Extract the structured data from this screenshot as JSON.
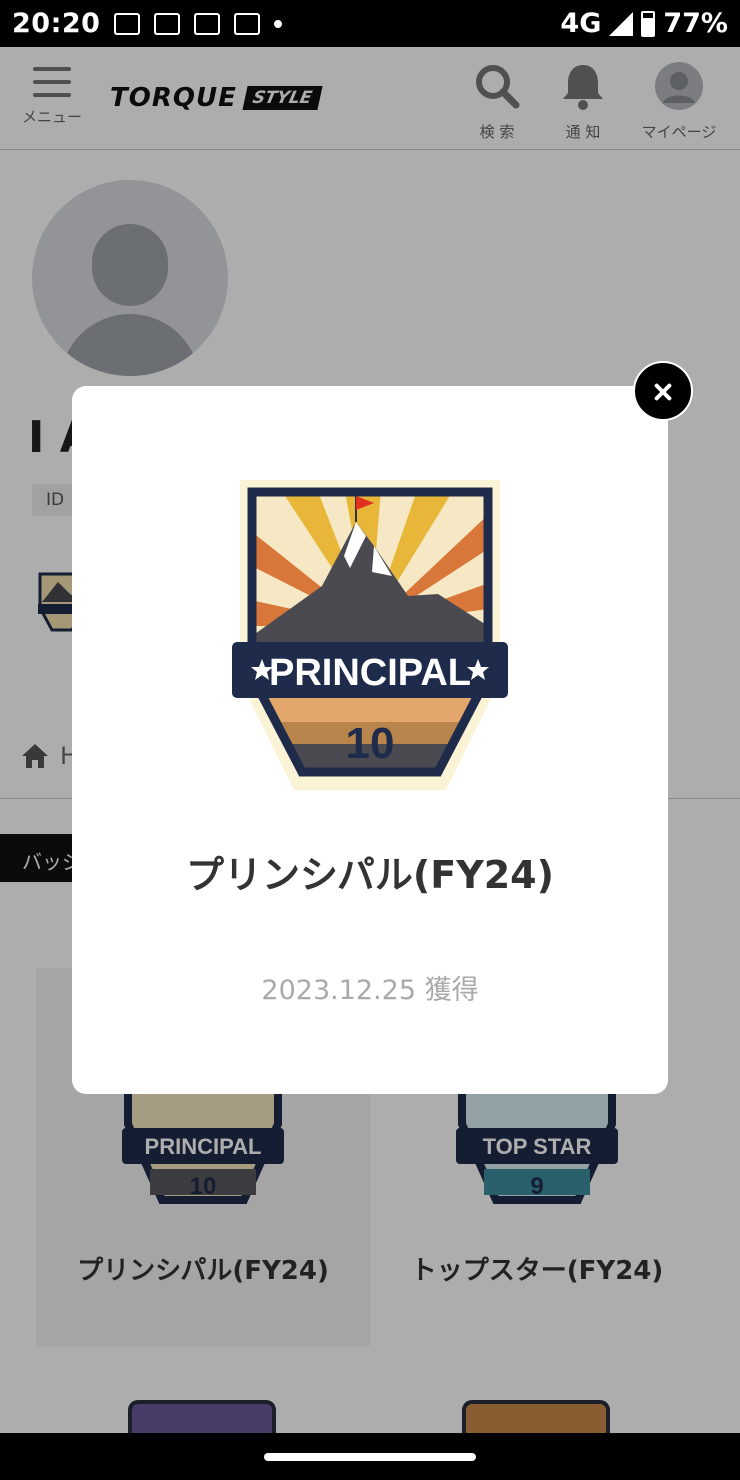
{
  "status_bar": {
    "time": "20:20",
    "network": "4G",
    "battery": "77%"
  },
  "header": {
    "menu_label": "メニュー",
    "logo_text": "TORQUE",
    "logo_tag": "STYLE",
    "search_label": "検 索",
    "notify_label": "通 知",
    "mypage_label": "マイページ"
  },
  "profile": {
    "name": "I A",
    "id_label": "ID"
  },
  "nav": {
    "home_text": "H"
  },
  "tabs": {
    "active_label": "バッジ"
  },
  "badges": [
    {
      "banner": "PRINCIPAL",
      "number": "10",
      "label": "プリンシパル(FY24)"
    },
    {
      "banner": "TOP STAR",
      "number": "9",
      "label": "トップスター(FY24)"
    }
  ],
  "modal": {
    "badge_banner": "PRINCIPAL",
    "badge_number": "10",
    "title": "プリンシパル(FY24)",
    "date": "2023.12.25 獲得"
  },
  "colors": {
    "navy": "#1f2b4a",
    "sun_yellow": "#e8b73a",
    "sun_orange": "#d9773a",
    "mountain": "#4a4a50",
    "flag": "#e0301e",
    "teal": "#3f8ea0"
  }
}
